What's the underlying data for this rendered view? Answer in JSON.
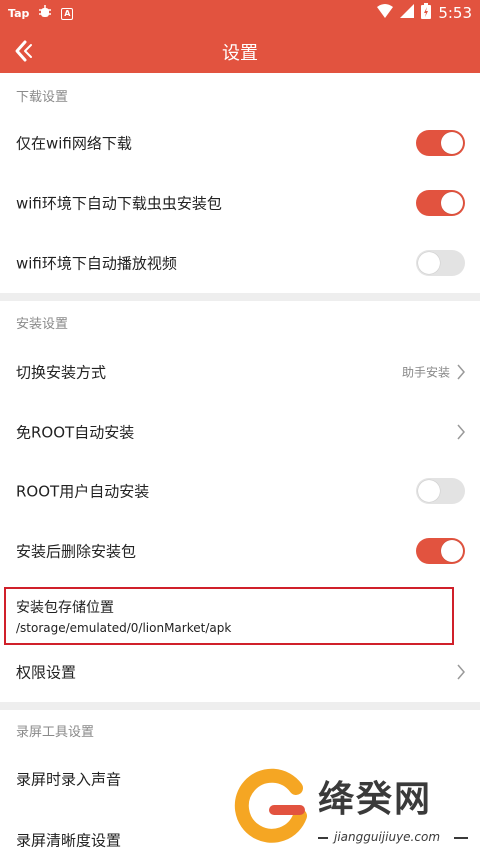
{
  "status": {
    "left_text": "Tap",
    "time": "5:53"
  },
  "header": {
    "title": "设置"
  },
  "download": {
    "title": "下载设置",
    "items": [
      {
        "label": "仅在wifi网络下载",
        "on": true
      },
      {
        "label": "wifi环境下自动下载虫虫安装包",
        "on": true
      },
      {
        "label": "wifi环境下自动播放视频",
        "on": false
      }
    ]
  },
  "install": {
    "title": "安装设置",
    "switch_method": {
      "label": "切换安装方式",
      "value": "助手安装"
    },
    "root_free": {
      "label": "免ROOT自动安装"
    },
    "root_user": {
      "label": "ROOT用户自动安装",
      "on": false
    },
    "delete_after": {
      "label": "安装后删除安装包",
      "on": true
    },
    "storage": {
      "label": "安装包存储位置",
      "path": "/storage/emulated/0/lionMarket/apk"
    },
    "permissions": {
      "label": "权限设置"
    }
  },
  "record": {
    "title": "录屏工具设置",
    "record_sound": {
      "label": "录屏时录入声音"
    },
    "clarity": {
      "label": "录屏清晰度设置"
    }
  },
  "watermark": {
    "brand": "绛癸网",
    "domain": "jiangguijiuye.com"
  },
  "colors": {
    "accent": "#e2533f",
    "highlight_border": "#d0202a"
  }
}
